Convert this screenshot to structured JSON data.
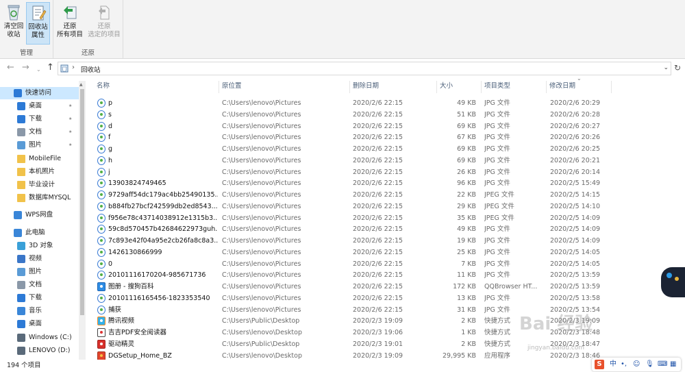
{
  "ribbon": {
    "empty_bin": "清空回\n收站",
    "empty_bin_l1": "清空回",
    "empty_bin_l2": "收站",
    "props_l1": "回收站",
    "props_l2": "属性",
    "group_manage": "管理",
    "restore_all_l1": "还原",
    "restore_all_l2": "所有项目",
    "restore_sel_l1": "还原",
    "restore_sel_l2": "选定的项目",
    "group_restore": "还原"
  },
  "address": {
    "path": "回收站"
  },
  "sidebar": {
    "items": [
      {
        "label": "快速访问",
        "icon": "star-icon"
      },
      {
        "label": "桌面",
        "icon": "desktop-icon",
        "pinned": true
      },
      {
        "label": "下载",
        "icon": "download-icon",
        "pinned": true
      },
      {
        "label": "文档",
        "icon": "document-icon",
        "pinned": true
      },
      {
        "label": "图片",
        "icon": "picture-icon",
        "pinned": true
      },
      {
        "label": "MobileFile",
        "icon": "folder-icon"
      },
      {
        "label": "本机照片",
        "icon": "folder-icon"
      },
      {
        "label": "毕业设计",
        "icon": "folder-icon"
      },
      {
        "label": "数据库MYSQL",
        "icon": "folder-icon"
      },
      {
        "label": "WPS网盘",
        "icon": "cloud-icon"
      },
      {
        "label": "此电脑",
        "icon": "computer-icon"
      },
      {
        "label": "3D 对象",
        "icon": "cube-icon"
      },
      {
        "label": "视频",
        "icon": "video-icon"
      },
      {
        "label": "图片",
        "icon": "picture-icon"
      },
      {
        "label": "文档",
        "icon": "document-icon"
      },
      {
        "label": "下载",
        "icon": "download-icon"
      },
      {
        "label": "音乐",
        "icon": "music-icon"
      },
      {
        "label": "桌面",
        "icon": "desktop-icon"
      },
      {
        "label": "Windows (C:)",
        "icon": "drive-icon"
      },
      {
        "label": "LENOVO (D:)",
        "icon": "drive-icon"
      }
    ]
  },
  "columns": {
    "name": "名称",
    "location": "原位置",
    "deleted": "删除日期",
    "size": "大小",
    "type": "项目类型",
    "modified": "修改日期"
  },
  "files": [
    {
      "name": "p",
      "loc": "C:\\Users\\lenovo\\Pictures",
      "del": "2020/2/6 22:15",
      "size": "49 KB",
      "type": "JPG 文件",
      "mod": "2020/2/6 20:29",
      "icon": "image-file-icon"
    },
    {
      "name": "s",
      "loc": "C:\\Users\\lenovo\\Pictures",
      "del": "2020/2/6 22:15",
      "size": "51 KB",
      "type": "JPG 文件",
      "mod": "2020/2/6 20:28",
      "icon": "image-file-icon"
    },
    {
      "name": "d",
      "loc": "C:\\Users\\lenovo\\Pictures",
      "del": "2020/2/6 22:15",
      "size": "69 KB",
      "type": "JPG 文件",
      "mod": "2020/2/6 20:27",
      "icon": "image-file-icon"
    },
    {
      "name": "f",
      "loc": "C:\\Users\\lenovo\\Pictures",
      "del": "2020/2/6 22:15",
      "size": "67 KB",
      "type": "JPG 文件",
      "mod": "2020/2/6 20:26",
      "icon": "image-file-icon"
    },
    {
      "name": "g",
      "loc": "C:\\Users\\lenovo\\Pictures",
      "del": "2020/2/6 22:15",
      "size": "69 KB",
      "type": "JPG 文件",
      "mod": "2020/2/6 20:25",
      "icon": "image-file-icon"
    },
    {
      "name": "h",
      "loc": "C:\\Users\\lenovo\\Pictures",
      "del": "2020/2/6 22:15",
      "size": "69 KB",
      "type": "JPG 文件",
      "mod": "2020/2/6 20:21",
      "icon": "image-file-icon"
    },
    {
      "name": "j",
      "loc": "C:\\Users\\lenovo\\Pictures",
      "del": "2020/2/6 22:15",
      "size": "26 KB",
      "type": "JPG 文件",
      "mod": "2020/2/6 20:14",
      "icon": "image-file-icon"
    },
    {
      "name": "13903824749465",
      "loc": "C:\\Users\\lenovo\\Pictures",
      "del": "2020/2/6 22:15",
      "size": "96 KB",
      "type": "JPG 文件",
      "mod": "2020/2/5 15:49",
      "icon": "image-file-icon"
    },
    {
      "name": "9729aff54dc179ac4bb25490135...",
      "loc": "C:\\Users\\lenovo\\Pictures",
      "del": "2020/2/6 22:15",
      "size": "22 KB",
      "type": "JPEG 文件",
      "mod": "2020/2/5 14:15",
      "icon": "image-file-icon"
    },
    {
      "name": "b884fb27bcf242599db2ed8543...",
      "loc": "C:\\Users\\lenovo\\Pictures",
      "del": "2020/2/6 22:15",
      "size": "29 KB",
      "type": "JPEG 文件",
      "mod": "2020/2/5 14:10",
      "icon": "image-file-icon"
    },
    {
      "name": "f956e78c43714038912e1315b3...",
      "loc": "C:\\Users\\lenovo\\Pictures",
      "del": "2020/2/6 22:15",
      "size": "35 KB",
      "type": "JPEG 文件",
      "mod": "2020/2/5 14:09",
      "icon": "image-file-icon"
    },
    {
      "name": "59c8d570457b42684622973guh...",
      "loc": "C:\\Users\\lenovo\\Pictures",
      "del": "2020/2/6 22:15",
      "size": "49 KB",
      "type": "JPG 文件",
      "mod": "2020/2/5 14:09",
      "icon": "image-file-icon"
    },
    {
      "name": "7c893e42f04a95e2cb26fa8c8a3...",
      "loc": "C:\\Users\\lenovo\\Pictures",
      "del": "2020/2/6 22:15",
      "size": "19 KB",
      "type": "JPG 文件",
      "mod": "2020/2/5 14:09",
      "icon": "image-file-icon"
    },
    {
      "name": "1426130866999",
      "loc": "C:\\Users\\lenovo\\Pictures",
      "del": "2020/2/6 22:15",
      "size": "25 KB",
      "type": "JPG 文件",
      "mod": "2020/2/5 14:05",
      "icon": "image-file-icon"
    },
    {
      "name": "0",
      "loc": "C:\\Users\\lenovo\\Pictures",
      "del": "2020/2/6 22:15",
      "size": "7 KB",
      "type": "JPG 文件",
      "mod": "2020/2/5 14:05",
      "icon": "image-file-icon"
    },
    {
      "name": "20101116170204-985671736",
      "loc": "C:\\Users\\lenovo\\Pictures",
      "del": "2020/2/6 22:15",
      "size": "11 KB",
      "type": "JPG 文件",
      "mod": "2020/2/5 13:59",
      "icon": "image-file-icon"
    },
    {
      "name": "图册 - 搜狗百科",
      "loc": "C:\\Users\\lenovo\\Pictures",
      "del": "2020/2/6 22:15",
      "size": "172 KB",
      "type": "QQBrowser HT...",
      "mod": "2020/2/5 13:59",
      "icon": "browser-file-icon"
    },
    {
      "name": "20101116165456-1823353540",
      "loc": "C:\\Users\\lenovo\\Pictures",
      "del": "2020/2/6 22:15",
      "size": "13 KB",
      "type": "JPG 文件",
      "mod": "2020/2/5 13:58",
      "icon": "image-file-icon"
    },
    {
      "name": "捕获",
      "loc": "C:\\Users\\lenovo\\Pictures",
      "del": "2020/2/6 22:15",
      "size": "31 KB",
      "type": "JPG 文件",
      "mod": "2020/2/5 13:54",
      "icon": "image-file-icon"
    },
    {
      "name": "腾讯视频",
      "loc": "C:\\Users\\Public\\Desktop",
      "del": "2020/2/3 19:09",
      "size": "2 KB",
      "type": "快捷方式",
      "mod": "2020/2/3 19:09",
      "icon": "video-app-icon"
    },
    {
      "name": "吉吉PDF安全阅读器",
      "loc": "C:\\Users\\lenovo\\Desktop",
      "del": "2020/2/3 19:06",
      "size": "1 KB",
      "type": "快捷方式",
      "mod": "2020/2/3 18:48",
      "icon": "pdf-app-icon"
    },
    {
      "name": "驱动精灵",
      "loc": "C:\\Users\\Public\\Desktop",
      "del": "2020/2/3 19:01",
      "size": "2 KB",
      "type": "快捷方式",
      "mod": "2020/2/3 18:47",
      "icon": "driver-app-icon"
    },
    {
      "name": "DGSetup_Home_BZ",
      "loc": "C:\\Users\\lenovo\\Desktop",
      "del": "2020/2/3 19:09",
      "size": "29,995 KB",
      "type": "应用程序",
      "mod": "2020/2/3 18:46",
      "icon": "setup-app-icon"
    }
  ],
  "status": {
    "count": "194 个项目"
  },
  "ime": {
    "lang": "中",
    "punct": "•,"
  },
  "watermark": {
    "text": "Bai 经验",
    "url": "jingyan.baidu.com"
  },
  "colors": {
    "selection": "#cce8ff",
    "header_text": "#4c607a",
    "sogou": "#e8512c"
  }
}
